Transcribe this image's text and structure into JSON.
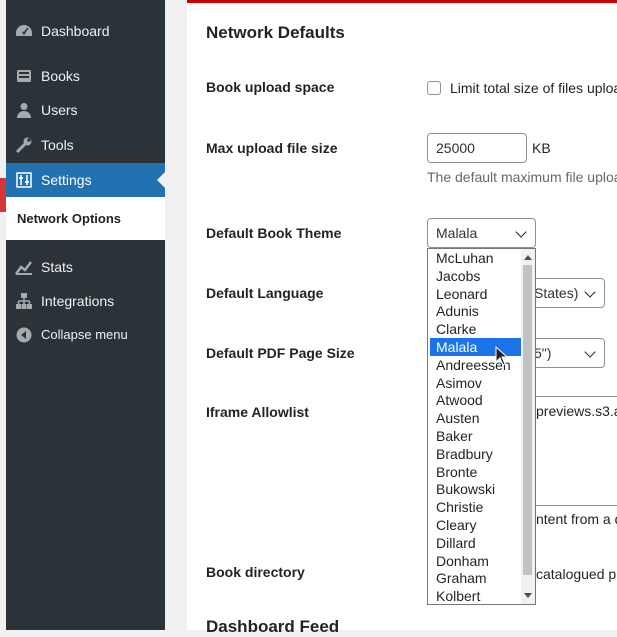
{
  "sidebar": {
    "items": [
      {
        "label": "Dashboard",
        "icon": "dashboard-icon"
      },
      {
        "label": "Books",
        "icon": "books-icon"
      },
      {
        "label": "Users",
        "icon": "users-icon"
      },
      {
        "label": "Tools",
        "icon": "tools-icon"
      },
      {
        "label": "Settings",
        "icon": "settings-icon"
      },
      {
        "label": "Stats",
        "icon": "stats-icon"
      },
      {
        "label": "Integrations",
        "icon": "integrations-icon"
      },
      {
        "label": "Collapse menu",
        "icon": "collapse-icon"
      }
    ],
    "submenu_label": "Network Options"
  },
  "main": {
    "section_title": "Network Defaults",
    "upload_space": {
      "label": "Book upload space",
      "checkbox_text": "Limit total size of files uploa"
    },
    "max_upload": {
      "label": "Max upload file size",
      "value": "25000",
      "unit": "KB",
      "desc": "The default maximum file uploa"
    },
    "theme": {
      "label": "Default Book Theme",
      "selected": "Malala"
    },
    "language": {
      "label": "Default Language",
      "value_partial": "States)"
    },
    "pdf_size": {
      "label": "Default PDF Page Size",
      "value_partial": "5\")"
    },
    "iframe": {
      "label": "Iframe Allowlist",
      "value_partial": "previews.s3.a",
      "desc_partial": "ntent from a d"
    },
    "book_dir": {
      "label": "Book directory",
      "text_partial": "catalogued pu"
    },
    "next_section_title": "Dashboard Feed"
  },
  "dropdown": {
    "options": [
      "McLuhan",
      "Jacobs",
      "Leonard",
      "Adunis",
      "Clarke",
      "Malala",
      "Andreessen",
      "Asimov",
      "Atwood",
      "Austen",
      "Baker",
      "Bradbury",
      "Bronte",
      "Bukowski",
      "Christie",
      "Cleary",
      "Dillard",
      "Donham",
      "Graham",
      "Kolbert"
    ],
    "selected_index": 5
  },
  "colors": {
    "sidebar_bg": "#2c3338",
    "accent": "#2271b1",
    "selected_option": "#1a73e8"
  }
}
